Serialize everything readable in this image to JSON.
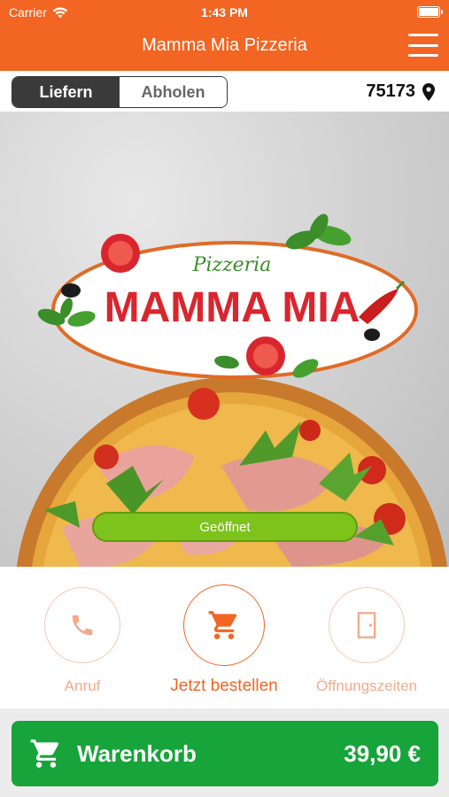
{
  "status": {
    "carrier": "Carrier",
    "time": "1:43 PM"
  },
  "nav": {
    "title": "Mamma Mia Pizzeria",
    "menu_icon": "hamburger-menu-icon"
  },
  "order_mode": {
    "options": [
      "Liefern",
      "Abholen"
    ],
    "selected": "Liefern"
  },
  "location": {
    "zip": "75173",
    "icon": "location-pin-icon"
  },
  "hero": {
    "logo_script": "Pizzeria",
    "logo_name": "MAMMA MIA",
    "status_pill": "Geöffnet",
    "colors": {
      "pill": "#7dc31c",
      "logo_red": "#d9262e",
      "logo_green": "#3b8e2a"
    }
  },
  "actions": [
    {
      "label": "Anruf",
      "icon": "phone-icon"
    },
    {
      "label": "Jetzt bestellen",
      "icon": "shopping-cart-icon"
    },
    {
      "label": "Öffnungszeiten",
      "icon": "door-icon"
    }
  ],
  "cart": {
    "label": "Warenkorb",
    "total": "39,90 €",
    "icon": "shopping-cart-icon"
  },
  "theme": {
    "primary": "#f26522",
    "cart_green": "#17a43a"
  }
}
